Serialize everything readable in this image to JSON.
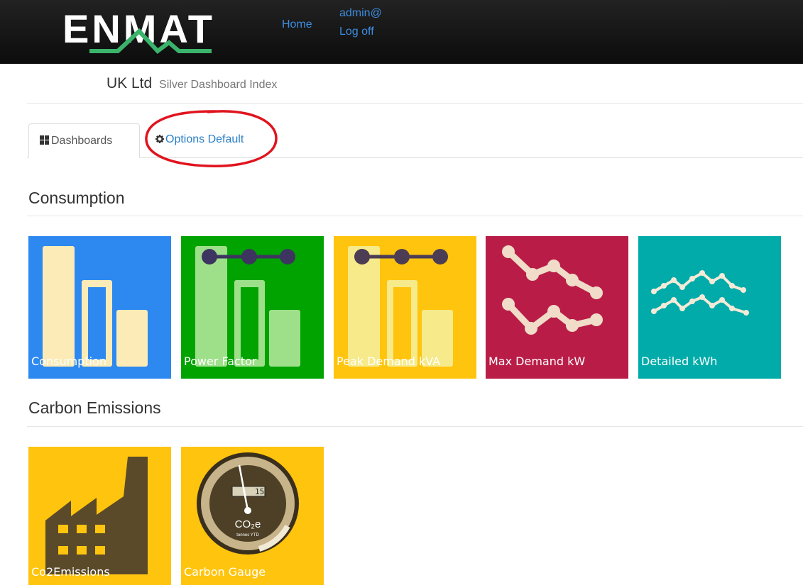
{
  "navbar": {
    "logo_text": "ENMAT",
    "home_label": "Home",
    "user_label": "admin@",
    "logoff_label": "Log off"
  },
  "page": {
    "title": "UK Ltd",
    "subtitle": "Silver Dashboard Index"
  },
  "tabs": {
    "dashboards_label": "Dashboards",
    "options_label": "Options Default"
  },
  "sections": [
    {
      "heading": "Consumption",
      "tiles": [
        {
          "label": "Consumption",
          "color": "#2d89ef",
          "icon": "bar-chart-icon"
        },
        {
          "label": "Power Factor",
          "color": "#00a300",
          "icon": "power-factor-icon"
        },
        {
          "label": "Peak Demand kVA",
          "color": "#ffc40d",
          "icon": "peak-demand-icon"
        },
        {
          "label": "Max Demand kW",
          "color": "#b91d47",
          "icon": "line-chart-icon"
        },
        {
          "label": "Detailed kWh",
          "color": "#00aba9",
          "icon": "wave-chart-icon"
        }
      ]
    },
    {
      "heading": "Carbon Emissions",
      "tiles": [
        {
          "label": "Co2Emissions",
          "color": "#ffc40d",
          "icon": "factory-icon"
        },
        {
          "label": "Carbon Gauge",
          "color": "#ffc40d",
          "icon": "gauge-icon"
        }
      ]
    }
  ],
  "gauge": {
    "readout": "15",
    "unit_main": "CO₂e",
    "unit_sub": "tonnes YTD"
  },
  "colors": {
    "navbar": "#111111",
    "link": "#2a7ec6",
    "annotation": "#e0141e",
    "tile_shape": "#fcebb6"
  }
}
